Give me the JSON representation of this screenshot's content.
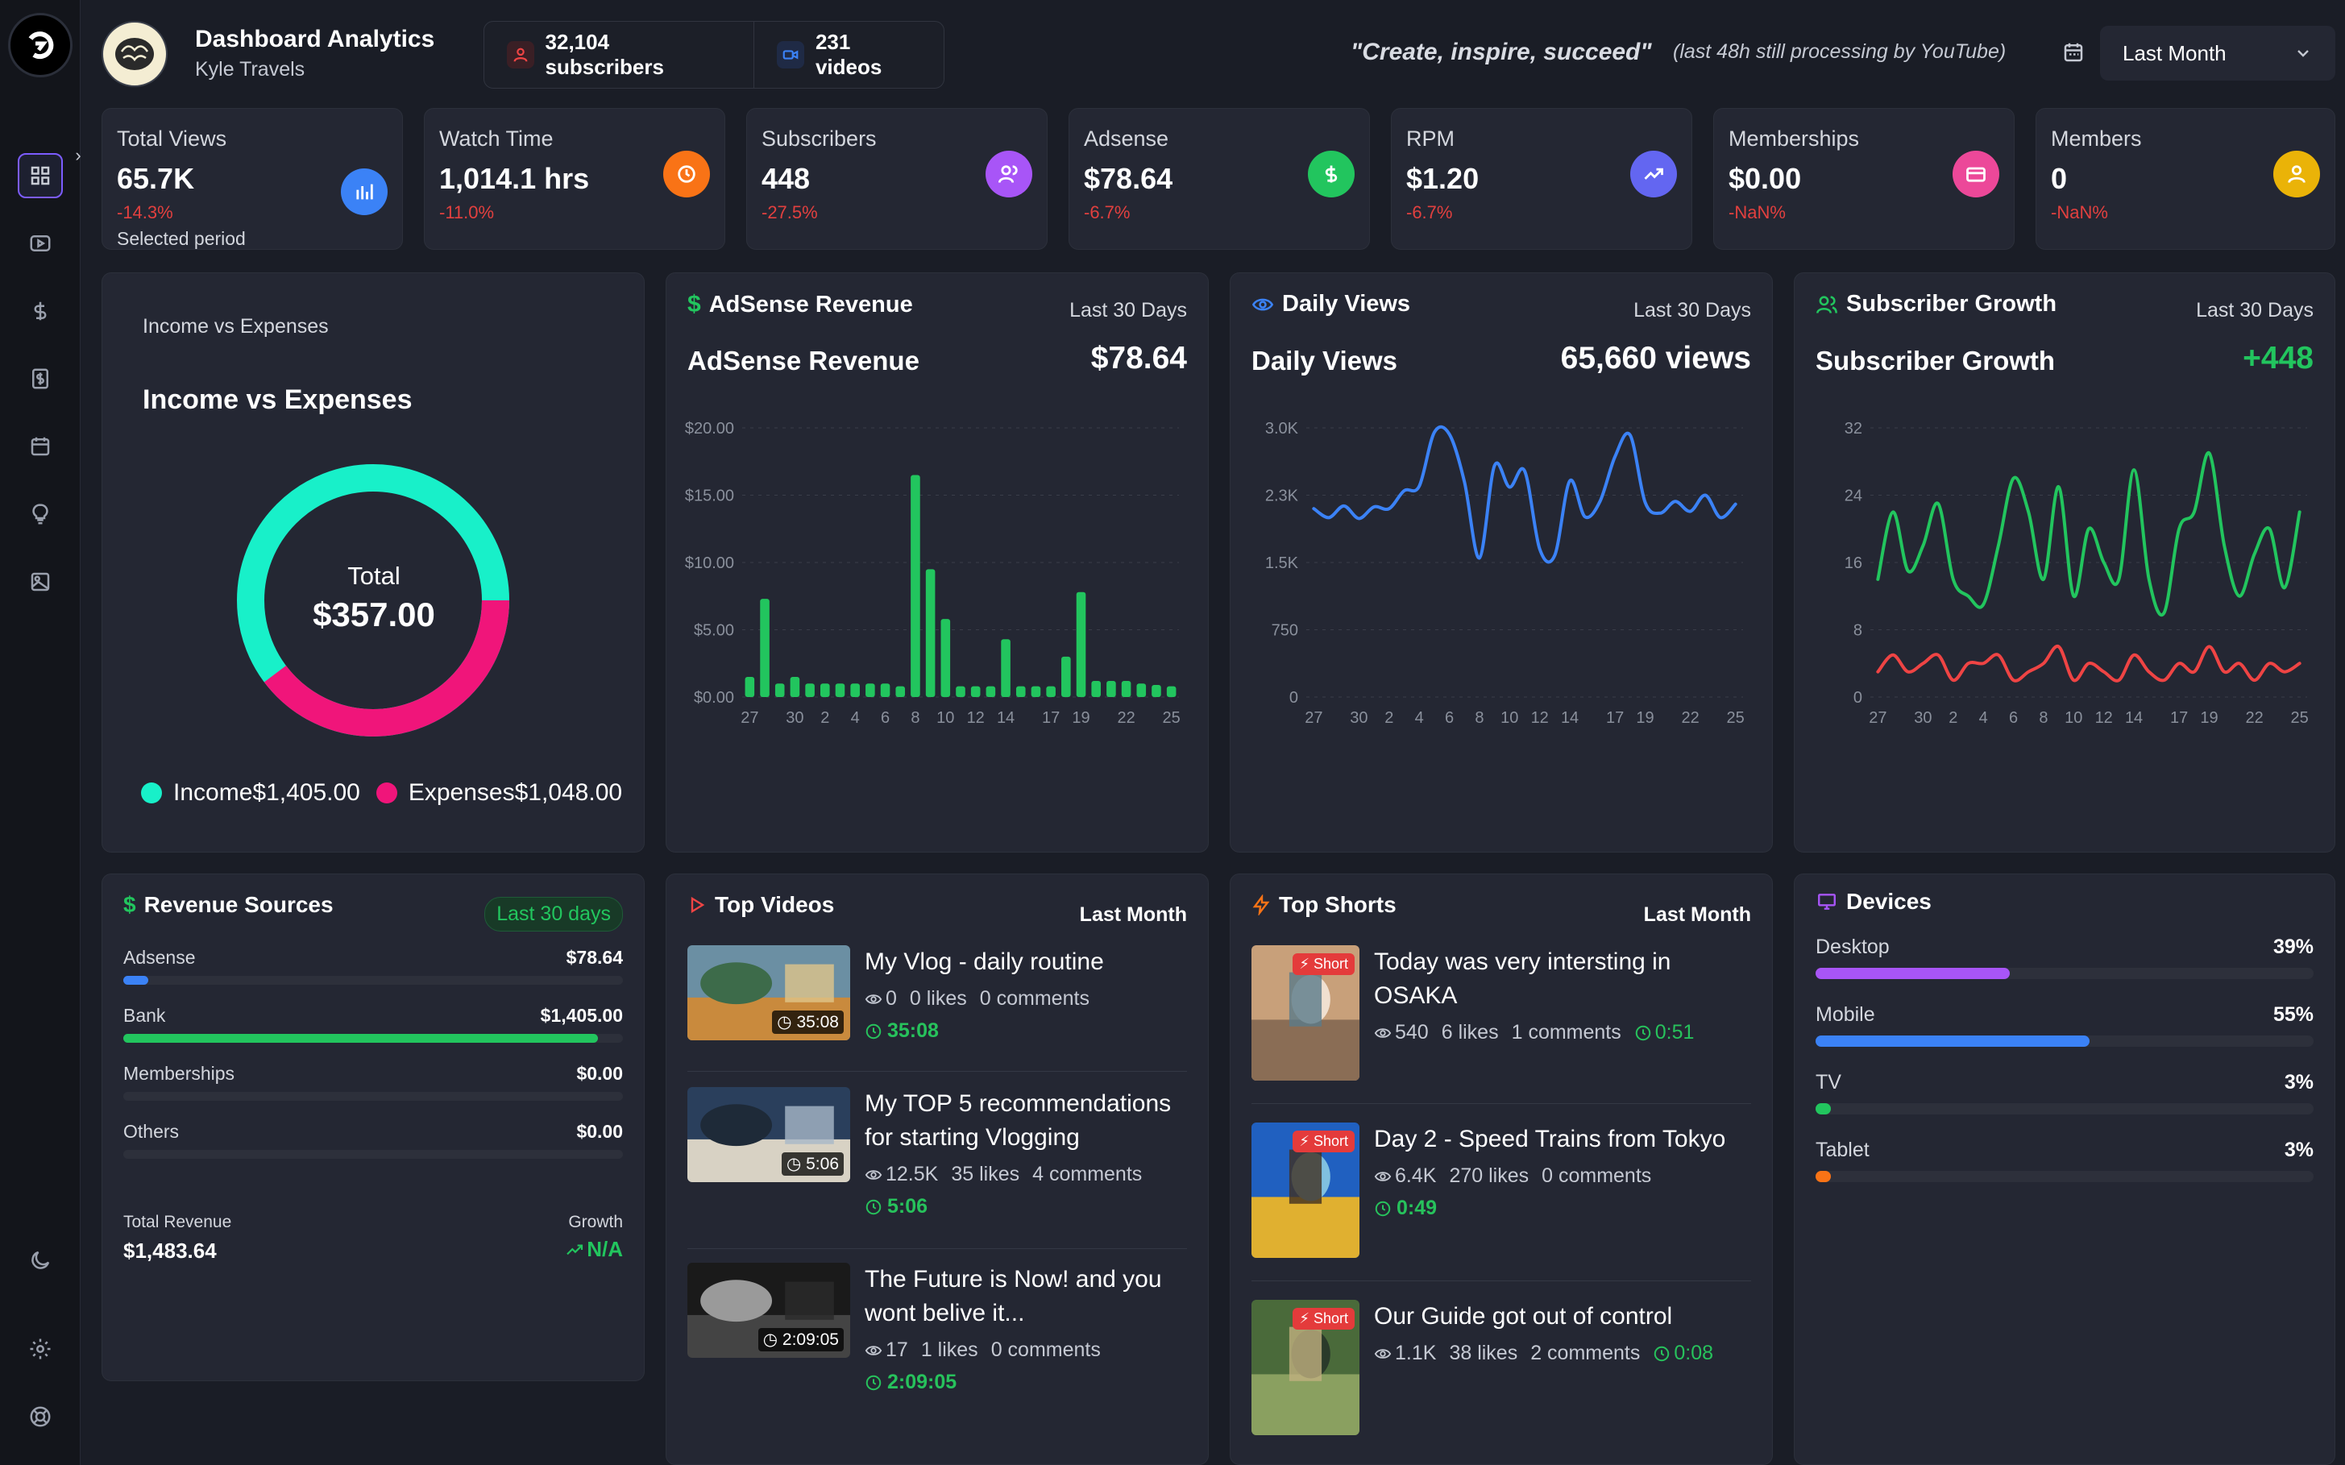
{
  "header": {
    "title": "Dashboard Analytics",
    "subtitle": "Kyle Travels",
    "subscribers": "32,104 subscribers",
    "videos": "231 videos",
    "quote": "\"Create, inspire, succeed\"",
    "note": "(last 48h still processing by YouTube)",
    "period": "Last Month"
  },
  "kpis": [
    {
      "label": "Total Views",
      "value": "65.7K",
      "delta": "-14.3%",
      "note": "Selected period",
      "icon": "bar-chart-icon",
      "color": "#3b82f6"
    },
    {
      "label": "Watch Time",
      "value": "1,014.1 hrs",
      "delta": "-11.0%",
      "icon": "clock-icon",
      "color": "#f97316"
    },
    {
      "label": "Subscribers",
      "value": "448",
      "delta": "-27.5%",
      "icon": "users-icon",
      "color": "#a855f7"
    },
    {
      "label": "Adsense",
      "value": "$78.64",
      "delta": "-6.7%",
      "icon": "dollar-icon",
      "color": "#22c55e"
    },
    {
      "label": "RPM",
      "value": "$1.20",
      "delta": "-6.7%",
      "icon": "trend-up-icon",
      "color": "#6366f1"
    },
    {
      "label": "Memberships",
      "value": "$0.00",
      "delta": "-NaN%",
      "icon": "card-icon",
      "color": "#ec4899"
    },
    {
      "label": "Members",
      "value": "0",
      "delta": "-NaN%",
      "icon": "user-icon",
      "color": "#eab308"
    }
  ],
  "income": {
    "header": "Income vs Expenses",
    "title": "Income vs Expenses",
    "total_label": "Total",
    "total_value": "$357.00",
    "income_label": "Income",
    "income_value": "$1,405.00",
    "expenses_label": "Expenses",
    "expenses_value": "$1,048.00",
    "colors": {
      "income": "#18f0c9",
      "expenses": "#f0157a"
    }
  },
  "adsense": {
    "header": "AdSense Revenue",
    "period": "Last 30 Days",
    "title": "AdSense Revenue",
    "value": "$78.64"
  },
  "views": {
    "header": "Daily Views",
    "period": "Last 30 Days",
    "title": "Daily Views",
    "value": "65,660 views"
  },
  "subs": {
    "header": "Subscriber Growth",
    "period": "Last 30 Days",
    "title": "Subscriber Growth",
    "value": "+448"
  },
  "chart_data": [
    {
      "type": "bar",
      "categories": [
        "27",
        "28",
        "29",
        "30",
        "1",
        "2",
        "3",
        "4",
        "5",
        "6",
        "7",
        "8",
        "9",
        "10",
        "11",
        "12",
        "13",
        "14",
        "15",
        "16",
        "17",
        "18",
        "19",
        "20",
        "21",
        "22",
        "23",
        "24",
        "25"
      ],
      "tick_labels": [
        "27",
        "30",
        "2",
        "4",
        "6",
        "8",
        "10",
        "12",
        "14",
        "17",
        "19",
        "22",
        "25"
      ],
      "values": [
        1.5,
        7.3,
        1.0,
        1.5,
        1.0,
        1.0,
        1.0,
        1.0,
        1.0,
        1.0,
        0.8,
        16.5,
        9.5,
        5.8,
        0.8,
        0.8,
        0.8,
        4.3,
        0.8,
        0.8,
        0.8,
        3.0,
        7.8,
        1.2,
        1.2,
        1.2,
        1.0,
        0.9,
        0.8
      ],
      "ylim": [
        0,
        20
      ],
      "yticks": [
        "$0.00",
        "$5.00",
        "$10.00",
        "$15.00",
        "$20.00"
      ],
      "color": "#22c55e"
    },
    {
      "type": "line",
      "x": [
        "27",
        "28",
        "29",
        "30",
        "1",
        "2",
        "3",
        "4",
        "5",
        "6",
        "7",
        "8",
        "9",
        "10",
        "11",
        "12",
        "13",
        "14",
        "15",
        "16",
        "17",
        "18",
        "19",
        "20",
        "21",
        "22",
        "23",
        "24",
        "25"
      ],
      "tick_labels": [
        "27",
        "30",
        "2",
        "4",
        "6",
        "8",
        "10",
        "12",
        "14",
        "17",
        "19",
        "22",
        "25"
      ],
      "values": [
        2100,
        2000,
        2130,
        1990,
        2120,
        2100,
        2300,
        2350,
        2950,
        2930,
        2400,
        1550,
        2580,
        2340,
        2520,
        1650,
        1580,
        2410,
        2010,
        2180,
        2680,
        2920,
        2170,
        2050,
        2180,
        2070,
        2250,
        2000,
        2150
      ],
      "ylim": [
        0,
        3000
      ],
      "yticks": [
        "0",
        "750",
        "1.5K",
        "2.3K",
        "3.0K"
      ],
      "color": "#3b82f6"
    },
    {
      "type": "line",
      "x": [
        "27",
        "28",
        "29",
        "30",
        "1",
        "2",
        "3",
        "4",
        "5",
        "6",
        "7",
        "8",
        "9",
        "10",
        "11",
        "12",
        "13",
        "14",
        "15",
        "16",
        "17",
        "18",
        "19",
        "20",
        "21",
        "22",
        "23",
        "24",
        "25"
      ],
      "tick_labels": [
        "27",
        "30",
        "2",
        "4",
        "6",
        "8",
        "10",
        "12",
        "14",
        "17",
        "19",
        "22",
        "25"
      ],
      "series": [
        {
          "values": [
            14,
            22,
            15,
            18,
            23,
            14,
            12,
            11,
            18,
            26,
            22,
            14,
            25,
            12,
            20,
            16,
            14,
            27,
            14,
            10,
            20,
            22,
            29,
            18,
            12,
            17,
            20,
            13,
            22
          ],
          "color": "#22c55e"
        },
        {
          "values": [
            3,
            5,
            3,
            4,
            5,
            2,
            4,
            4,
            5,
            2,
            3,
            4,
            6,
            2,
            4,
            3,
            2,
            5,
            3,
            2,
            4,
            3,
            6,
            3,
            4,
            2,
            4,
            3,
            4
          ],
          "color": "#ef4444"
        }
      ],
      "ylim": [
        0,
        32
      ],
      "yticks": [
        "0",
        "8",
        "16",
        "24",
        "32"
      ]
    }
  ],
  "revenue": {
    "header": "Revenue Sources",
    "badge": "Last 30 days",
    "items": [
      {
        "label": "Adsense",
        "value": "$78.64",
        "fraction": 0.05,
        "color": "#3b82f6"
      },
      {
        "label": "Bank",
        "value": "$1,405.00",
        "fraction": 0.95,
        "color": "#22c55e"
      },
      {
        "label": "Memberships",
        "value": "$0.00",
        "fraction": 0,
        "color": "#a855f7"
      },
      {
        "label": "Others",
        "value": "$0.00",
        "fraction": 0,
        "color": "#f97316"
      }
    ],
    "total_label": "Total Revenue",
    "total_value": "$1,483.64",
    "growth_label": "Growth",
    "growth_value": "N/A"
  },
  "top_videos": {
    "header": "Top Videos",
    "period": "Last Month",
    "items": [
      {
        "title": "My Vlog - daily routine",
        "views": "0",
        "likes": "0 likes",
        "comments": "0 comments",
        "duration": "35:08"
      },
      {
        "title": "My TOP 5 recommendations for starting Vlogging",
        "views": "12.5K",
        "likes": "35 likes",
        "comments": "4 comments",
        "duration": "5:06"
      },
      {
        "title": "The Future is Now! and you wont belive it...",
        "views": "17",
        "likes": "1 likes",
        "comments": "0 comments",
        "duration": "2:09:05"
      }
    ]
  },
  "top_shorts": {
    "header": "Top Shorts",
    "period": "Last Month",
    "badge": "Short",
    "items": [
      {
        "title": "Today was very intersting in OSAKA",
        "views": "540",
        "likes": "6 likes",
        "comments": "1 comments",
        "duration": "0:51"
      },
      {
        "title": "Day 2 - Speed Trains from Tokyo",
        "views": "6.4K",
        "likes": "270 likes",
        "comments": "0 comments",
        "duration": "0:49"
      },
      {
        "title": "Our Guide got out of control",
        "views": "1.1K",
        "likes": "38 likes",
        "comments": "2 comments",
        "duration": "0:08"
      }
    ]
  },
  "devices": {
    "header": "Devices",
    "items": [
      {
        "label": "Desktop",
        "pct": "39%",
        "fraction": 0.39,
        "color": "#a855f7"
      },
      {
        "label": "Mobile",
        "pct": "55%",
        "fraction": 0.55,
        "color": "#3b82f6"
      },
      {
        "label": "TV",
        "pct": "3%",
        "fraction": 0.03,
        "color": "#22c55e"
      },
      {
        "label": "Tablet",
        "pct": "3%",
        "fraction": 0.03,
        "color": "#f97316"
      }
    ]
  }
}
